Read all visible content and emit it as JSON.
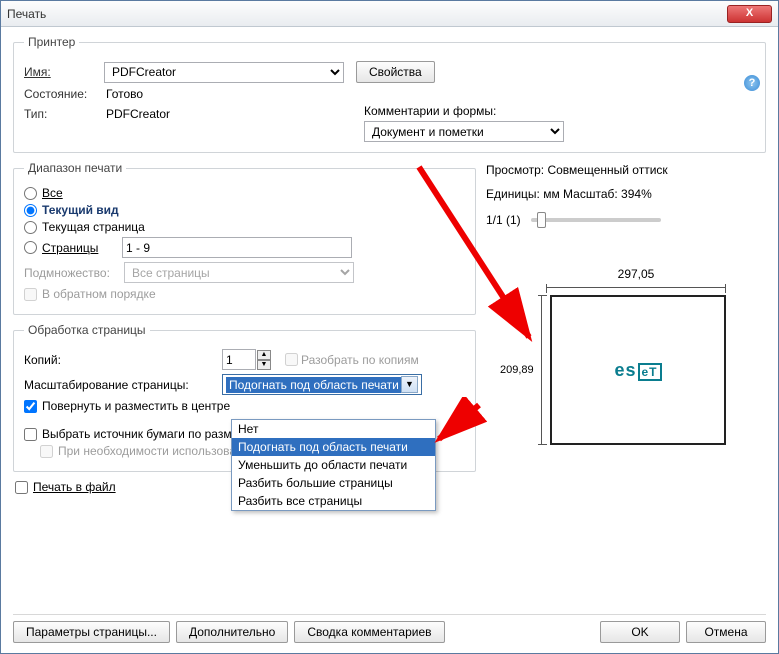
{
  "window": {
    "title": "Печать"
  },
  "printer": {
    "group": "Принтер",
    "name_label": "Имя:",
    "name_value": "PDFCreator",
    "properties_btn": "Свойства",
    "status_label": "Состояние:",
    "status_value": "Готово",
    "type_label": "Тип:",
    "type_value": "PDFCreator",
    "comments_label": "Комментарии и формы:",
    "comments_value": "Документ и пометки"
  },
  "range": {
    "group": "Диапазон печати",
    "all": "Все",
    "current_view": "Текущий вид",
    "current_page": "Текущая страница",
    "pages": "Страницы",
    "pages_value": "1 - 9",
    "subset_label": "Подмножество:",
    "subset_value": "Все страницы",
    "reverse": "В обратном порядке"
  },
  "handling": {
    "group": "Обработка страницы",
    "copies_label": "Копий:",
    "copies_value": "1",
    "collate": "Разобрать по копиям",
    "scaling_label": "Масштабирование страницы:",
    "scaling_value": "Подогнать под область печати",
    "scaling_options": [
      "Нет",
      "Подогнать под область печати",
      "Уменьшить до области печати",
      "Разбить большие страницы",
      "Разбить все страницы"
    ],
    "rotate": "Повернуть и разместить в центре",
    "source": "Выбрать источник бумаги по размеру страницы PDF",
    "use_custom": "При необходимости использовать другой источник"
  },
  "print_to_file": "Печать в файл",
  "preview": {
    "title": "Просмотр: Совмещенный оттиск",
    "units": "Единицы: мм Масштаб: 394%",
    "page_indicator": "1/1 (1)",
    "width": "297,05",
    "height": "209,89",
    "logo": "eseT"
  },
  "buttons": {
    "page_setup": "Параметры страницы...",
    "advanced": "Дополнительно",
    "summary": "Сводка комментариев",
    "ok": "OK",
    "cancel": "Отмена"
  }
}
